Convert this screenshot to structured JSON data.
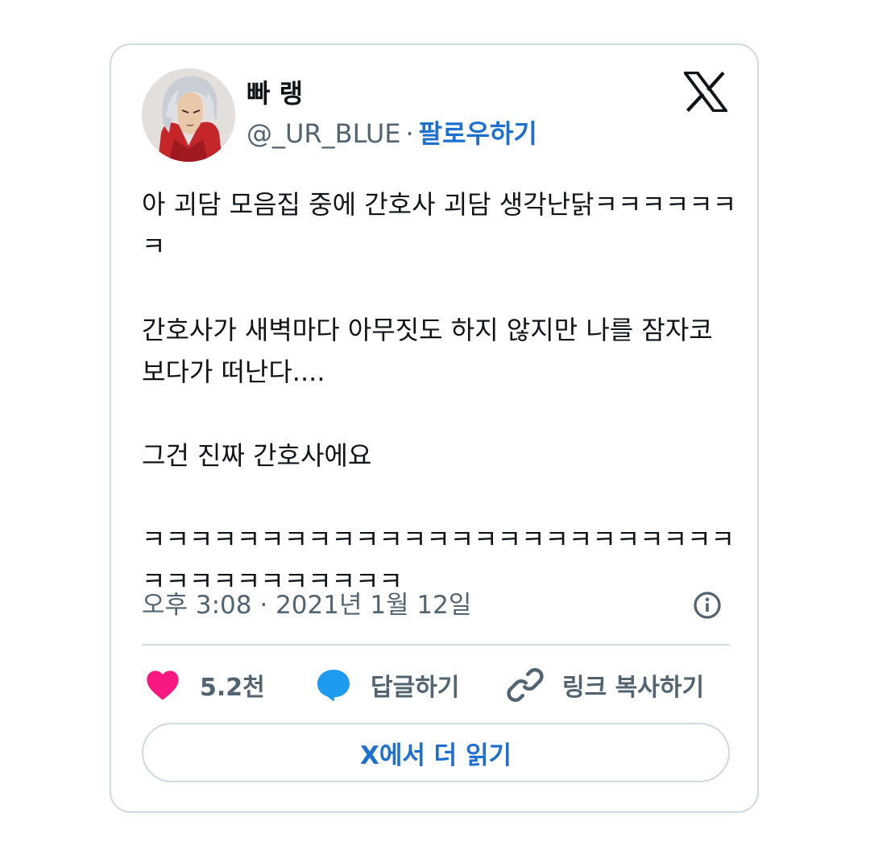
{
  "user": {
    "display_name": "빠 랭",
    "handle": "@_UR_BLUE",
    "separator": "·",
    "follow_label": "팔로우하기"
  },
  "tweet": {
    "paragraphs": [
      "아 괴담 모음집 중에 간호사 괴담 생각난닭ㅋㅋㅋㅋㅋㅋㅋ",
      "간호사가 새벽마다 아무짓도 하지 않지만 나를 잠자코 보다가 떠난다....",
      "그건 진짜 간호사에요",
      "ㅋㅋㅋㅋㅋㅋㅋㅋㅋㅋㅋㅋㅋㅋㅋㅋㅋㅋㅋㅋㅋㅋㅋㅋㅋㅋㅋㅋㅋㅋㅋㅋㅋㅋㅋㅋ"
    ],
    "timestamp": "오후 3:08 · 2021년 1월 12일"
  },
  "actions": {
    "like_count": "5.2천",
    "reply_label": "답글하기",
    "copy_link_label": "링크 복사하기"
  },
  "read_more_label": "X에서 더 읽기",
  "colors": {
    "accent": "#1d6fd0",
    "like": "#f91880",
    "reply": "#1d9bf0",
    "muted": "#536471",
    "border": "#cfd9de",
    "text": "#0f1419"
  },
  "icons": {
    "brand": "x-logo-icon",
    "info": "info-icon",
    "like": "heart-icon",
    "reply": "speech-bubble-icon",
    "copy_link": "link-icon"
  }
}
